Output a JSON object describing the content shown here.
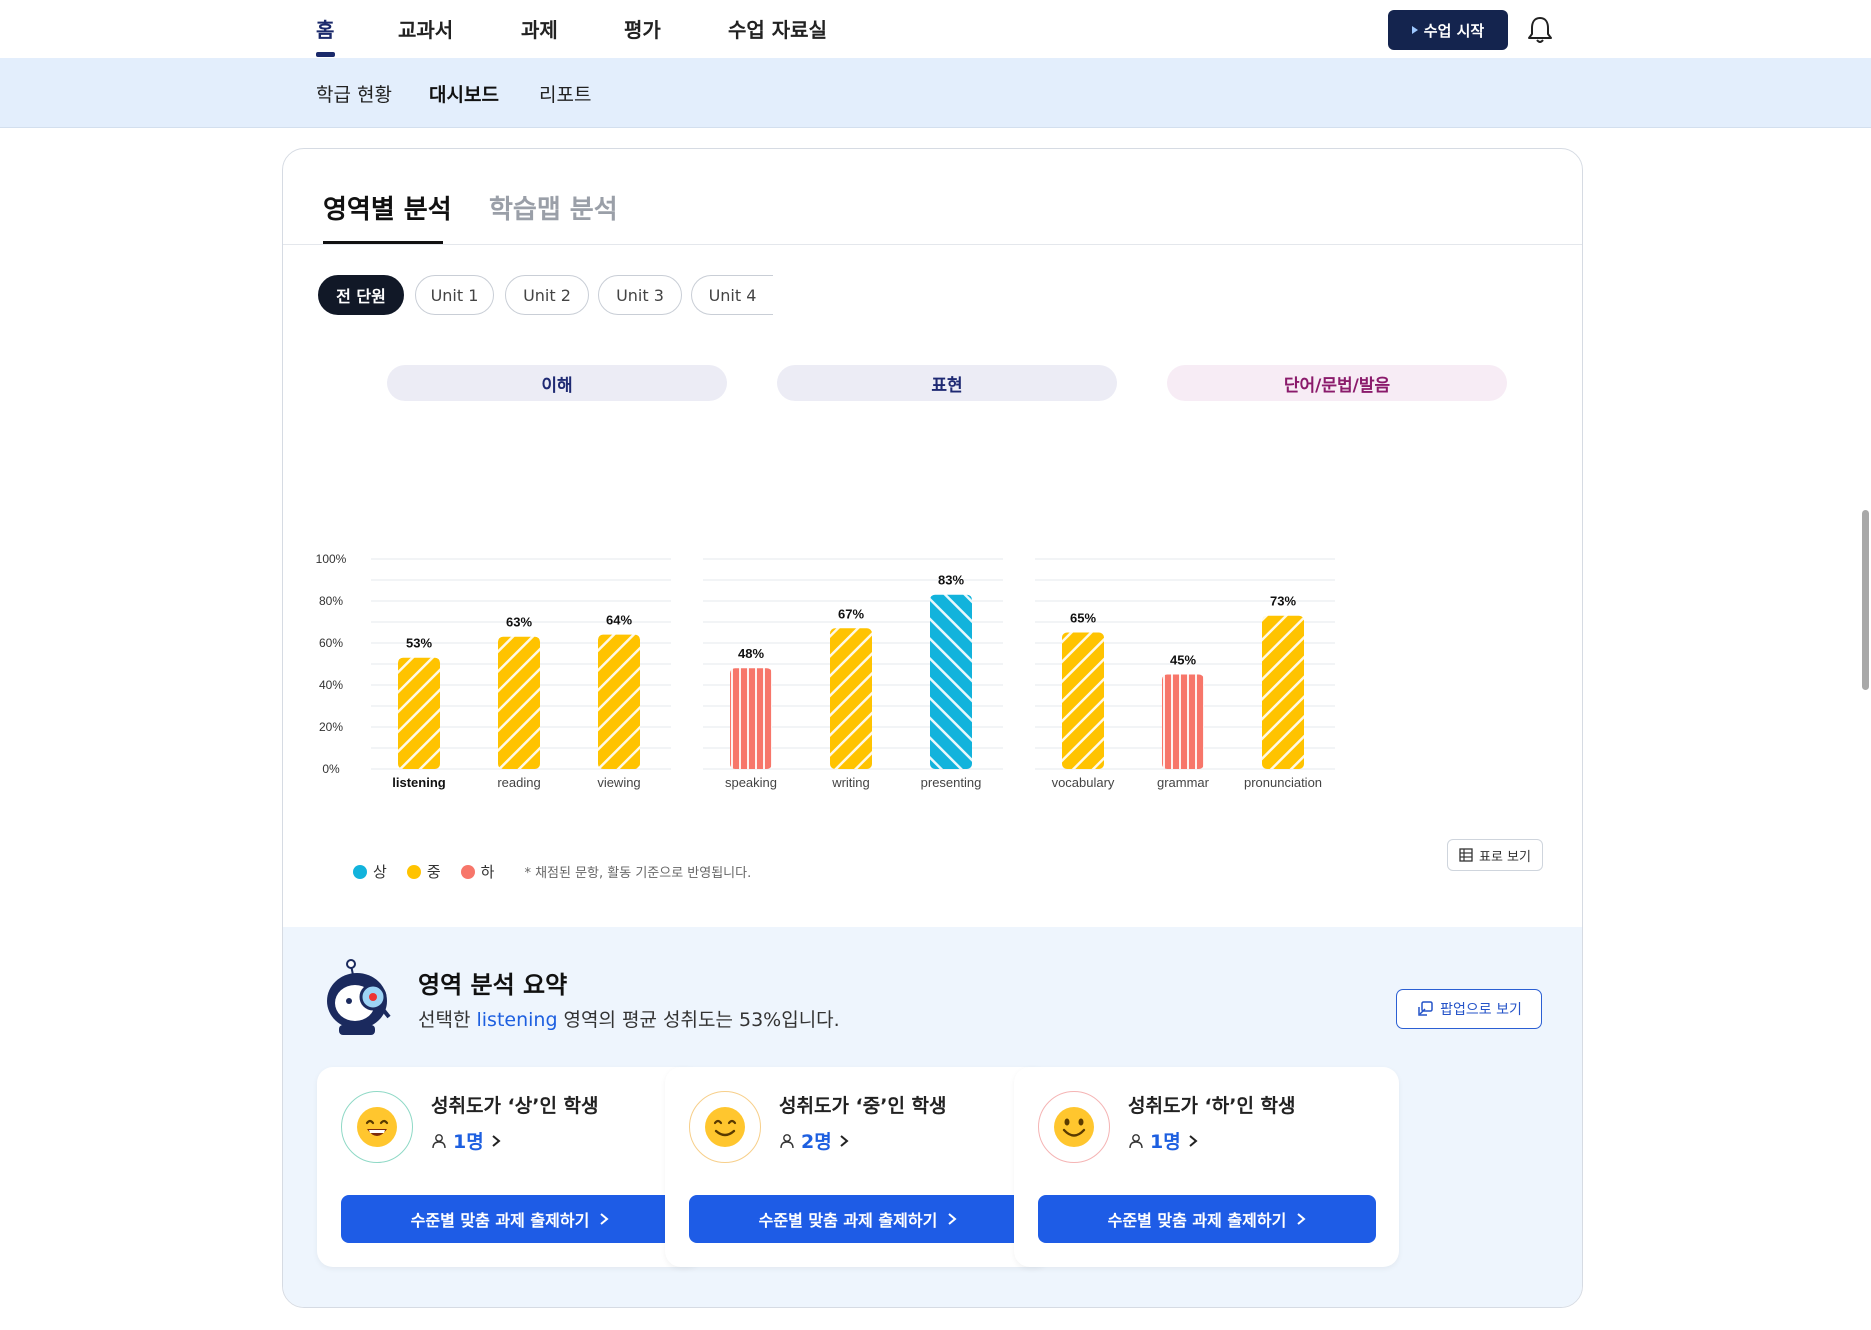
{
  "topnav": {
    "items": [
      "홈",
      "교과서",
      "과제",
      "평가",
      "수업 자료실"
    ],
    "start_button": "수업 시작"
  },
  "subnav": {
    "items": [
      "학급 현황",
      "대시보드",
      "리포트"
    ]
  },
  "tabs": [
    "영역별 분석",
    "학습맵 분석"
  ],
  "unit_chips": [
    "전 단원",
    "Unit 1",
    "Unit 2",
    "Unit 3",
    "Unit 4"
  ],
  "groups": [
    "이해",
    "표현",
    "단어/문법/발음"
  ],
  "colors": {
    "high": "#12b3dc",
    "mid": "#ffc300",
    "low": "#f7766a"
  },
  "chart_data": {
    "type": "bar",
    "ylim": [
      0,
      100
    ],
    "yticks": [
      "0%",
      "20%",
      "40%",
      "60%",
      "80%",
      "100%"
    ],
    "groups": [
      {
        "name": "이해",
        "categories": [
          "listening",
          "reading",
          "viewing"
        ],
        "values": [
          53,
          63,
          64
        ],
        "levels": [
          "mid",
          "mid",
          "mid"
        ],
        "labels": [
          "53%",
          "63%",
          "64%"
        ]
      },
      {
        "name": "표현",
        "categories": [
          "speaking",
          "writing",
          "presenting"
        ],
        "values": [
          48,
          67,
          83
        ],
        "levels": [
          "low",
          "mid",
          "high"
        ],
        "labels": [
          "48%",
          "67%",
          "83%"
        ]
      },
      {
        "name": "단어/문법/발음",
        "categories": [
          "vocabulary",
          "grammar",
          "pronunciation"
        ],
        "values": [
          65,
          45,
          73
        ],
        "levels": [
          "mid",
          "low",
          "mid"
        ],
        "labels": [
          "65%",
          "45%",
          "73%"
        ]
      }
    ],
    "selected_category": "listening"
  },
  "legend": {
    "items": [
      {
        "label": "상",
        "level": "high"
      },
      {
        "label": "중",
        "level": "mid"
      },
      {
        "label": "하",
        "level": "low"
      }
    ],
    "note": "* 채점된 문항, 활동 기준으로 반영됩니다."
  },
  "table_button": "표로 보기",
  "summary": {
    "title": "영역 분석 요약",
    "desc_pre": "선택한 ",
    "desc_hl": "listening",
    "desc_post": " 영역의 평균 성취도는 53%입니다.",
    "popup_button": "팝업으로 보기",
    "cards": [
      {
        "title": "성취도가 ‘상’인 학생",
        "count": "1명",
        "button": "수준별 맞춤 과제 출제하기",
        "ring": "#8fd9c6"
      },
      {
        "title": "성취도가 ‘중’인 학생",
        "count": "2명",
        "button": "수준별 맞춤 과제 출제하기",
        "ring": "#f7cf8a"
      },
      {
        "title": "성취도가 ‘하’인 학생",
        "count": "1명",
        "button": "수준별 맞춤 과제 출제하기",
        "ring": "#f5b4b4"
      }
    ]
  }
}
